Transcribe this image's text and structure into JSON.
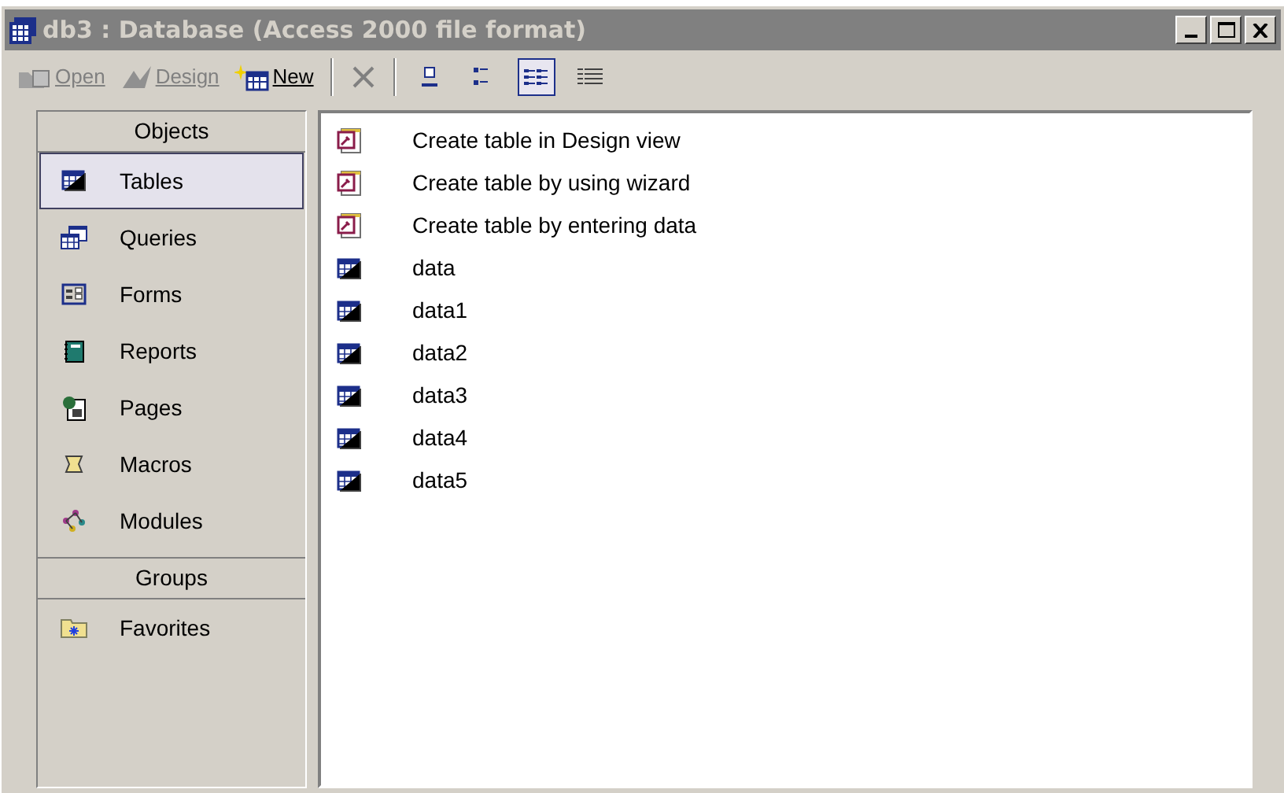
{
  "window": {
    "title": "db3 : Database (Access 2000 file format)"
  },
  "toolbar": {
    "actions": [
      {
        "kind": "open",
        "label": "Open",
        "disabled": true
      },
      {
        "kind": "design",
        "label": "Design",
        "disabled": true
      },
      {
        "kind": "new",
        "label": "New",
        "disabled": false
      },
      {
        "kind": "delete",
        "disabled": true
      }
    ],
    "views": [
      {
        "kind": "large",
        "selected": false
      },
      {
        "kind": "small",
        "selected": false
      },
      {
        "kind": "list",
        "selected": true
      },
      {
        "kind": "details",
        "selected": false
      }
    ]
  },
  "sidebar": {
    "objects_header": "Objects",
    "items": [
      {
        "kind": "table",
        "label": "Tables",
        "selected": true
      },
      {
        "kind": "query",
        "label": "Queries",
        "selected": false
      },
      {
        "kind": "form",
        "label": "Forms",
        "selected": false
      },
      {
        "kind": "report",
        "label": "Reports",
        "selected": false
      },
      {
        "kind": "page",
        "label": "Pages",
        "selected": false
      },
      {
        "kind": "macro",
        "label": "Macros",
        "selected": false
      },
      {
        "kind": "module",
        "label": "Modules",
        "selected": false
      }
    ],
    "groups_header": "Groups",
    "groups": [
      {
        "kind": "favorites",
        "label": "Favorites",
        "selected": false
      }
    ]
  },
  "list": {
    "items": [
      {
        "kind": "shortcut",
        "label": "Create table in Design view"
      },
      {
        "kind": "shortcut",
        "label": "Create table by using wizard"
      },
      {
        "kind": "shortcut",
        "label": "Create table by entering data"
      },
      {
        "kind": "table",
        "label": "data"
      },
      {
        "kind": "table",
        "label": "data1"
      },
      {
        "kind": "table",
        "label": "data2"
      },
      {
        "kind": "table",
        "label": "data3"
      },
      {
        "kind": "table",
        "label": "data4"
      },
      {
        "kind": "table",
        "label": "data5"
      }
    ]
  }
}
